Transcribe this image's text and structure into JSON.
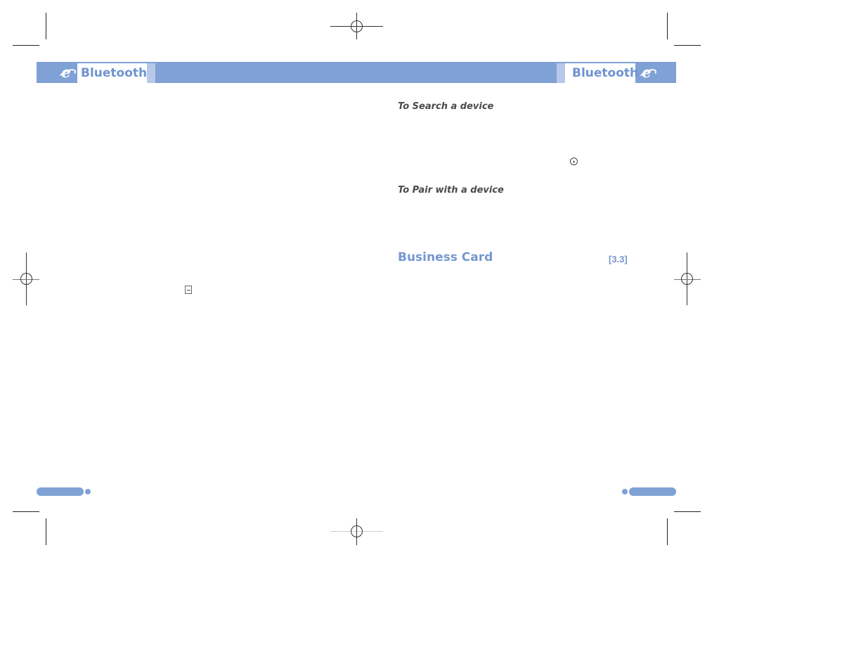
{
  "header": {
    "left_title": "Bluetooth",
    "right_title": "Bluetooth",
    "left_icon": "ie-e-icon",
    "right_icon": "ie-e-icon"
  },
  "content": {
    "subheads": [
      {
        "label": "To Search a device"
      },
      {
        "label": "To Pair with a device"
      }
    ],
    "section": {
      "title": "Business Card",
      "number": "[3.3]"
    },
    "inline_icons": [
      {
        "name": "ok-key-icon",
        "glyph": "⏚"
      },
      {
        "name": "soft-key-icon",
        "glyph": ""
      }
    ]
  },
  "colors": {
    "accent": "#7fa1d5",
    "accent_light": "#b7c8e8",
    "heading_blue": "#7597d0",
    "subhead_gray": "#4a4a4a"
  }
}
